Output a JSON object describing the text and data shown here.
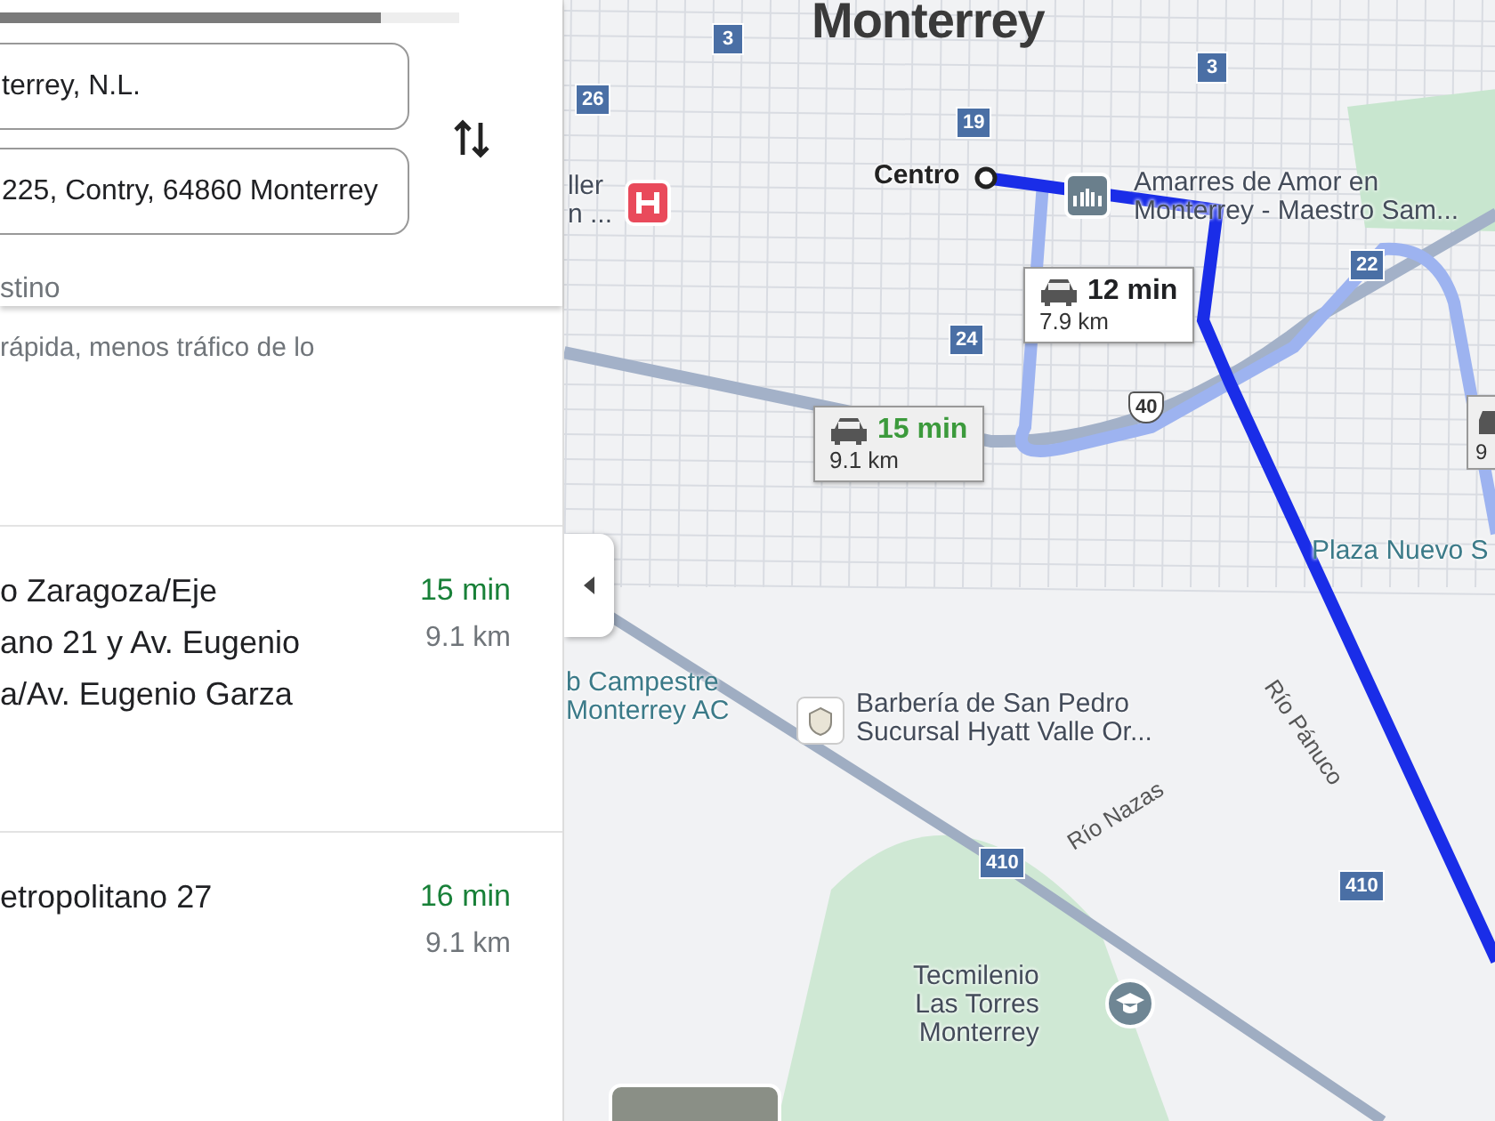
{
  "panel": {
    "progress": {
      "level": 0.83
    },
    "origin": "terrey, N.L.",
    "destination": "225, Contry, 64860 Monterrey",
    "add_stop": "stino"
  },
  "routes": [
    {
      "description": "rápida, menos tráfico de lo"
    },
    {
      "via": [
        "o Zaragoza/Eje",
        "ano 21 y Av. Eugenio",
        "a/Av. Eugenio Garza"
      ],
      "time": "15 min",
      "distance": "9.1 km"
    },
    {
      "via": [
        "etropolitano 27"
      ],
      "time": "16 min",
      "distance": "9.1 km"
    }
  ],
  "map": {
    "city": "Monterrey",
    "shields": [
      {
        "text": "3",
        "kind": "box"
      },
      {
        "text": "26",
        "kind": "box"
      },
      {
        "text": "19",
        "kind": "box"
      },
      {
        "text": "3",
        "kind": "box"
      },
      {
        "text": "24",
        "kind": "box"
      },
      {
        "text": "22",
        "kind": "box"
      },
      {
        "text": "40",
        "kind": "interstate"
      },
      {
        "text": "410",
        "kind": "box"
      },
      {
        "text": "410",
        "kind": "box"
      }
    ],
    "places": [
      {
        "lines": [
          "Centro"
        ],
        "kind": "bold"
      },
      {
        "lines": [
          "ller",
          "n ..."
        ],
        "kind": "label"
      },
      {
        "lines": [
          "Amarres de Amor en",
          "Monterrey - Maestro Sam..."
        ],
        "kind": "label"
      },
      {
        "lines": [
          "Plaza Nuevo S"
        ],
        "kind": "park"
      },
      {
        "lines": [
          "b Campestre",
          "Monterrey AC"
        ],
        "kind": "park"
      },
      {
        "lines": [
          "Barbería de San Pedro",
          "Sucursal Hyatt Valle Or..."
        ],
        "kind": "label"
      },
      {
        "lines": [
          "Río Nazas"
        ],
        "kind": "street"
      },
      {
        "lines": [
          "Río Pánuco"
        ],
        "kind": "street"
      },
      {
        "lines": [
          "Tecmilenio",
          "Las Torres",
          "Monterrey"
        ],
        "kind": "label"
      }
    ],
    "callouts": [
      {
        "time": "12 min",
        "distance": "7.9 km",
        "selected": true
      },
      {
        "time": "15 min",
        "distance": "9.1 km",
        "selected": false
      }
    ],
    "edge_callout": "9"
  }
}
